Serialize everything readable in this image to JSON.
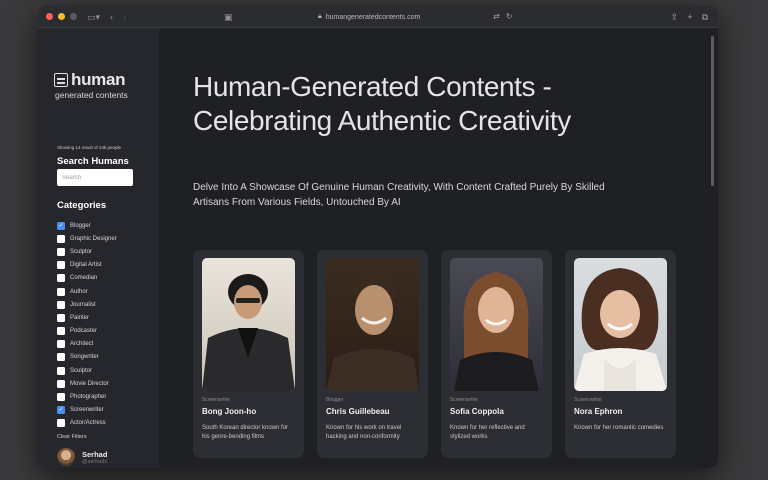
{
  "browser": {
    "url": "humangeneratedcontents.com"
  },
  "sidebar": {
    "logo_word": "human",
    "logo_sub": "generated contents",
    "showing": "Showing 14 result of 24k people",
    "search_title": "Search Humans",
    "search_placeholder": "Search",
    "categories_title": "Categories",
    "categories": [
      {
        "label": "Blogger",
        "checked": true
      },
      {
        "label": "Graphic Designer",
        "checked": false
      },
      {
        "label": "Sculptor",
        "checked": false
      },
      {
        "label": "Digital Artist",
        "checked": false
      },
      {
        "label": "Comedian",
        "checked": false
      },
      {
        "label": "Author",
        "checked": false
      },
      {
        "label": "Journalist",
        "checked": false
      },
      {
        "label": "Painter",
        "checked": false
      },
      {
        "label": "Podcaster",
        "checked": false
      },
      {
        "label": "Architect",
        "checked": false
      },
      {
        "label": "Songwriter",
        "checked": false
      },
      {
        "label": "Sculptor",
        "checked": false
      },
      {
        "label": "Movie Director",
        "checked": false
      },
      {
        "label": "Photographer",
        "checked": false
      },
      {
        "label": "Screenwriter",
        "checked": true
      },
      {
        "label": "Actor/Actress",
        "checked": false
      }
    ],
    "clear_filters": "Clear Filters",
    "user_name": "Serhad",
    "user_handle": "@serhadx"
  },
  "main": {
    "title": "Human-Generated Contents - Celebrating Authentic Creativity",
    "subtitle": "Delve Into A Showcase Of Genuine Human Creativity, With Content Crafted Purely By Skilled Artisans From Various Fields, Untouched By AI",
    "cards": [
      {
        "role": "Screenwriter",
        "name": "Bong Joon-ho",
        "desc": "South Korean director known for his genre-bending films"
      },
      {
        "role": "Blogger",
        "name": "Chris Guillebeau",
        "desc": "Known for his work on travel hacking and non-conformity"
      },
      {
        "role": "Screenwriter",
        "name": "Sofia Coppola",
        "desc": "Known for her reflective and stylized works"
      },
      {
        "role": "Screenwriter",
        "name": "Nora Ephron",
        "desc": "Known for her romantic comedies"
      }
    ]
  },
  "colors": {
    "accent": "#4a8df0",
    "window_bg": "#1f2023",
    "sidebar_bg": "#26272c",
    "card_bg": "#2d2e33"
  }
}
